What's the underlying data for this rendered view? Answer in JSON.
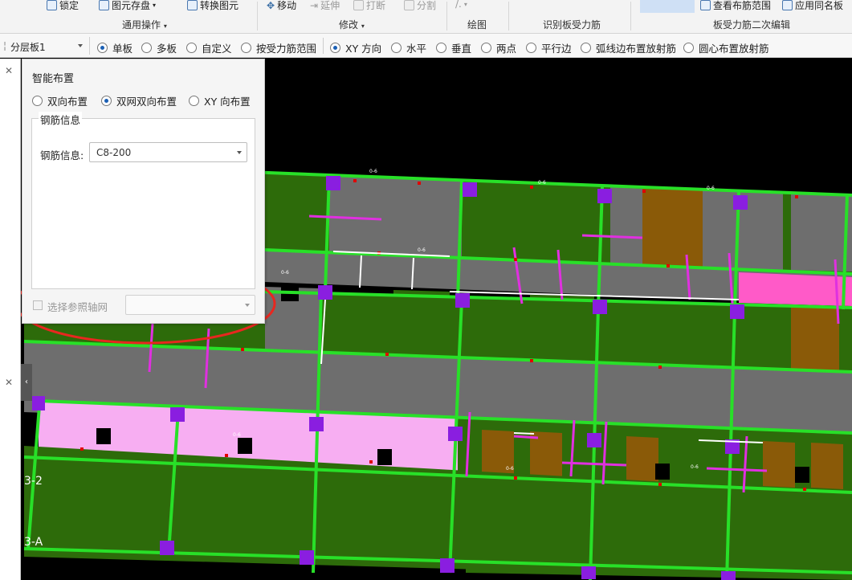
{
  "ribbon": {
    "lock_label": "锁定",
    "unit_save_label": "图元存盘",
    "convert_label": "转换图元",
    "move_label": "移动",
    "extend_label": "延伸",
    "break_label": "打断",
    "split_label": "分割",
    "view_range_label": "查看布筋范围",
    "apply_same_label": "应用同名板",
    "groups": {
      "general": "通用操作",
      "modify": "修改",
      "draw": "绘图",
      "identify": "识别板受力筋",
      "secondary_edit": "板受力筋二次编辑"
    }
  },
  "layer_select": {
    "value": "分层板1"
  },
  "placement_modes": [
    {
      "label": "单板",
      "selected": true
    },
    {
      "label": "多板",
      "selected": false
    },
    {
      "label": "自定义",
      "selected": false
    },
    {
      "label": "按受力筋范围",
      "selected": false
    }
  ],
  "direction_modes": [
    {
      "label": "XY 方向",
      "selected": true
    },
    {
      "label": "水平",
      "selected": false
    },
    {
      "label": "垂直",
      "selected": false
    },
    {
      "label": "两点",
      "selected": false
    },
    {
      "label": "平行边",
      "selected": false
    },
    {
      "label": "弧线边布置放射筋",
      "selected": false
    },
    {
      "label": "圆心布置放射筋",
      "selected": false
    }
  ],
  "panel": {
    "title": "智能布置",
    "options": [
      {
        "label": "双向布置",
        "selected": false
      },
      {
        "label": "双网双向布置",
        "selected": true
      },
      {
        "label": "XY 向布置",
        "selected": false
      }
    ],
    "group_title": "钢筋信息",
    "rebar_label": "钢筋信息:",
    "rebar_value": "C8-200",
    "axis_checkbox_label": "选择参照轴网",
    "axis_checked": false,
    "axis_value": ""
  },
  "canvas": {
    "axis_labels": [
      "3-2",
      "3-A"
    ],
    "rebar_tag": "0-6",
    "annotation_color": "#e8271f"
  },
  "colors": {
    "slab_green": "#2d6b0a",
    "slab_grey": "#6e6e6e",
    "slab_pink": "#f7aef2",
    "slab_brown": "#8a5a08",
    "beam_green": "#28e028",
    "rebar_magenta": "#e030e0",
    "column_purple": "#8a1ee0"
  }
}
